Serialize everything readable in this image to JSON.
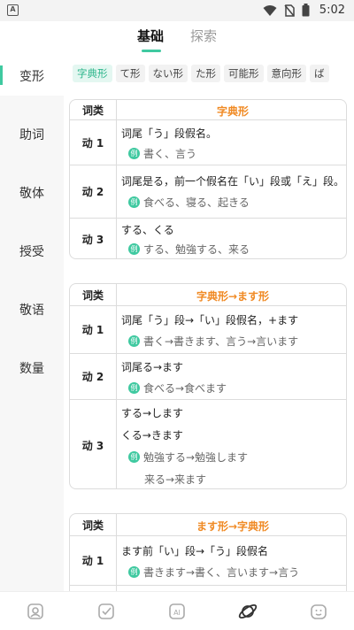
{
  "status": {
    "time": "5:02",
    "app_badge": "A"
  },
  "top_tabs": [
    {
      "label": "基础",
      "active": true
    },
    {
      "label": "探索",
      "active": false
    }
  ],
  "sidebar": {
    "items": [
      {
        "label": "变形",
        "active": true
      },
      {
        "label": "助词",
        "active": false
      },
      {
        "label": "敬体",
        "active": false
      },
      {
        "label": "授受",
        "active": false
      },
      {
        "label": "敬语",
        "active": false
      },
      {
        "label": "数量",
        "active": false
      }
    ]
  },
  "chips": [
    "字典形",
    "て形",
    "ない形",
    "た形",
    "可能形",
    "意向形",
    "ば"
  ],
  "example_icon": "例",
  "tables": [
    {
      "col_header": "词类",
      "title": "字典形",
      "rows": [
        {
          "label": "动 1",
          "rule": "词尾「う」段假名。",
          "examples": [
            "書く、言う"
          ]
        },
        {
          "label": "动 2",
          "rule": "词尾是る，前一个假名在「い」段或「え」段。",
          "examples": [
            "食べる、寝る、起きる"
          ]
        },
        {
          "label": "动 3",
          "rule": "する、くる",
          "examples": [
            "する、勉強する、来る"
          ]
        }
      ]
    },
    {
      "col_header": "词类",
      "title": "字典形→ます形",
      "rows": [
        {
          "label": "动 1",
          "rule": "词尾「う」段→「い」段假名，+ます",
          "examples": [
            "書く→書きます、言う→言います"
          ]
        },
        {
          "label": "动 2",
          "rule": "词尾る→ます",
          "examples": [
            "食べる→食べます"
          ]
        },
        {
          "label": "动 3",
          "rules": [
            "する→します",
            "くる→きます"
          ],
          "examples": [
            "勉強する→勉強します",
            "来る→来ます"
          ]
        }
      ]
    },
    {
      "col_header": "词类",
      "title": "ます形→字典形",
      "rows": [
        {
          "label": "动 1",
          "rule": "ます前「い」段→「う」段假名",
          "examples": [
            "書きます→書く、言います→言う"
          ]
        }
      ]
    }
  ]
}
